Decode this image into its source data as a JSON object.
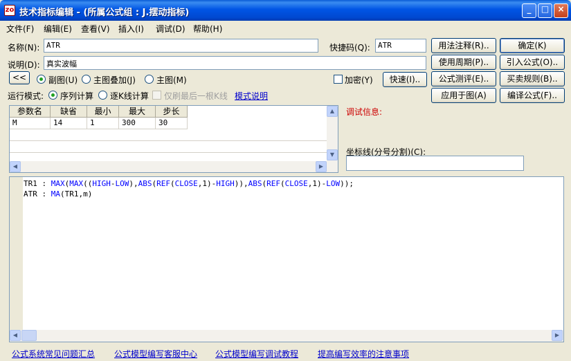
{
  "window": {
    "title": "技术指标编辑 - (所属公式组 : J.摆动指标)",
    "icon_label": "zo",
    "controls": {
      "minimize": "_",
      "maximize": "□",
      "close": "×"
    }
  },
  "menu": [
    "文件(F)",
    "编辑(E)",
    "查看(V)",
    "插入(I)",
    "调试(D)",
    "帮助(H)"
  ],
  "form": {
    "name_label": "名称(N):",
    "name_value": "ATR",
    "desc_label": "说明(D):",
    "desc_value": "真实波幅",
    "shortcut_label": "快捷码(Q):",
    "shortcut_value": "ATR",
    "collapse_label": "<<",
    "chart_options": [
      "副图(U)",
      "主图叠加(J)",
      "主图(M)"
    ],
    "chart_selected": "副图(U)",
    "encrypt_label": "加密(Y)",
    "quick_button": "快速(I)..",
    "run_mode_label": "运行模式:",
    "run_modes": [
      "序列计算",
      "逐K线计算"
    ],
    "run_mode_selected": "序列计算",
    "last_bar_only_label": "仅刷最后一根K线",
    "mode_help_link": "模式说明"
  },
  "buttons": {
    "usage_notes": "用法注释(R)..",
    "ok": "确定(K)",
    "use_period": "使用周期(P)..",
    "import_formula": "引入公式(O)..",
    "formula_test": "公式测评(E)..",
    "trading_rules": "买卖规则(B)..",
    "apply_to_chart": "应用于图(A)",
    "compile_formula": "编译公式(F).."
  },
  "params": {
    "headers": [
      "参数名",
      "缺省",
      "最小",
      "最大",
      "步长"
    ],
    "rows": [
      [
        "M",
        "14",
        "1",
        "300",
        "30"
      ]
    ]
  },
  "debug": {
    "label": "调试信息:",
    "axis_label": "坐标线(分号分割)(C):",
    "axis_value": ""
  },
  "code": {
    "lines": [
      [
        [
          "TR1 : ",
          "plain"
        ],
        [
          "MAX",
          "kw"
        ],
        [
          "(",
          "plain"
        ],
        [
          "MAX",
          "kw"
        ],
        [
          "((",
          "plain"
        ],
        [
          "HIGH",
          "kw"
        ],
        [
          "-",
          "plain"
        ],
        [
          "LOW",
          "kw"
        ],
        [
          "),",
          "plain"
        ],
        [
          "ABS",
          "kw"
        ],
        [
          "(",
          "plain"
        ],
        [
          "REF",
          "kw"
        ],
        [
          "(",
          "plain"
        ],
        [
          "CLOSE",
          "kw"
        ],
        [
          ",1)-",
          "plain"
        ],
        [
          "HIGH",
          "kw"
        ],
        [
          ")),",
          "plain"
        ],
        [
          "ABS",
          "kw"
        ],
        [
          "(",
          "plain"
        ],
        [
          "REF",
          "kw"
        ],
        [
          "(",
          "plain"
        ],
        [
          "CLOSE",
          "kw"
        ],
        [
          ",1)-",
          "plain"
        ],
        [
          "LOW",
          "kw"
        ],
        [
          "));",
          "plain"
        ]
      ],
      [
        [
          "ATR : ",
          "plain"
        ],
        [
          "MA",
          "kw"
        ],
        [
          "(TR1,m)",
          "plain"
        ]
      ]
    ]
  },
  "footer_links": [
    "公式系统常见问题汇总",
    "公式模型编写客服中心",
    "公式模型编写调试教程",
    "提高编写效率的注意事项"
  ],
  "colors": {
    "debug_label": "#cc0000",
    "keyword": "#0000ff",
    "link": "#0000cc"
  }
}
